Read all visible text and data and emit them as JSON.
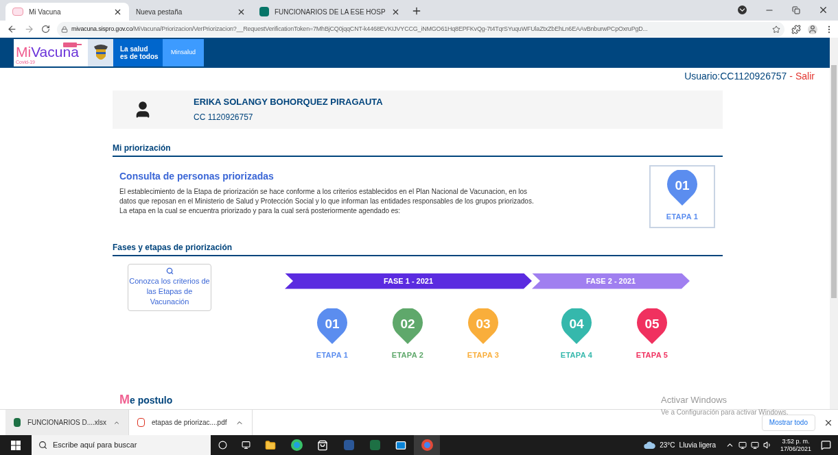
{
  "browser": {
    "tabs": [
      {
        "title": "Mi Vacuna",
        "kind": "site",
        "selected": true
      },
      {
        "title": "Nueva pestaña",
        "kind": "blank",
        "selected": false
      },
      {
        "title": "FUNCIONARIOS DE LA ESE HOSP",
        "kind": "forms",
        "selected": false
      }
    ],
    "url_host": "mivacuna.sispro.gov.co",
    "url_path": "/MiVacuna/Priorizacion/VerPriorizacion?__RequestVerificationToken=7MhBjCQ0jqqCNT-k4468EVKIJVYCCG_iNMGO61Hq8EPFKvQg-7t4TqrSYuquWFUlaZtxZbEhLn6EAAvBnburwPCpOxruPgD..."
  },
  "header": {
    "logo_parts": [
      "Mi",
      "Vacuna"
    ],
    "logo_sub": "Covid-19",
    "slogan_lines": [
      "La salud",
      "es de todos"
    ],
    "ministry": "Minsalud"
  },
  "user_bar": {
    "label": "Usuario:CC1120926757",
    "separator": "-",
    "logout": "Salir"
  },
  "profile": {
    "name": "ERIKA SOLANGY BOHORQUEZ PIRAGAUTA",
    "document": "CC 1120926757"
  },
  "my_priority": {
    "heading": "Mi priorización",
    "title": "Consulta de personas priorizadas",
    "text_lines": [
      "El establecimiento de la Etapa de priorización se hace conforme a los criterios establecidos en el Plan Nacional de Vacunacion, en los",
      "datos que reposan en el Ministerio de Salud y Protección Social y lo que informan las entidades responsables de los grupos priorizados.",
      "La etapa en la cual se encuentra priorizado y para la cual será posteriormente agendado es:"
    ],
    "stage": {
      "number": "01",
      "label": "ETAPA 1",
      "color": "#5b8def"
    }
  },
  "phases_section": {
    "heading": "Fases y etapas de priorización",
    "criteria_link": "Conozca los criterios de las Etapas de Vacunación",
    "phases": [
      {
        "label": "FASE 1 - 2021",
        "color": "#5b2be0",
        "stages": [
          {
            "number": "01",
            "label": "ETAPA 1",
            "color": "#5b8def"
          },
          {
            "number": "02",
            "label": "ETAPA 2",
            "color": "#5fa86b"
          },
          {
            "number": "03",
            "label": "ETAPA 3",
            "color": "#f9ae3b"
          }
        ]
      },
      {
        "label": "FASE 2 - 2021",
        "color": "#a07ff0",
        "stages": [
          {
            "number": "04",
            "label": "ETAPA 4",
            "color": "#35b8ac"
          },
          {
            "number": "05",
            "label": "ETAPA 5",
            "color": "#f0315f"
          }
        ]
      }
    ]
  },
  "apply_section": {
    "heading_parts": [
      "M",
      "e postulo"
    ]
  },
  "activation_notice": {
    "title": "Activar Windows",
    "text": "Ve a Configuración para activar Windows."
  },
  "downloads": {
    "files": [
      {
        "name": "FUNCIONARIOS D....xlsx",
        "kind": "excel",
        "selected": true
      },
      {
        "name": "etapas de priorizac....pdf",
        "kind": "pdf",
        "selected": false
      }
    ],
    "show_all": "Mostrar todo"
  },
  "taskbar": {
    "search_placeholder": "Escribe aquí para buscar",
    "temperature": "23°C",
    "weather": "Lluvia ligera",
    "time": "3:52 p. m.",
    "date": "17/06/2021"
  }
}
